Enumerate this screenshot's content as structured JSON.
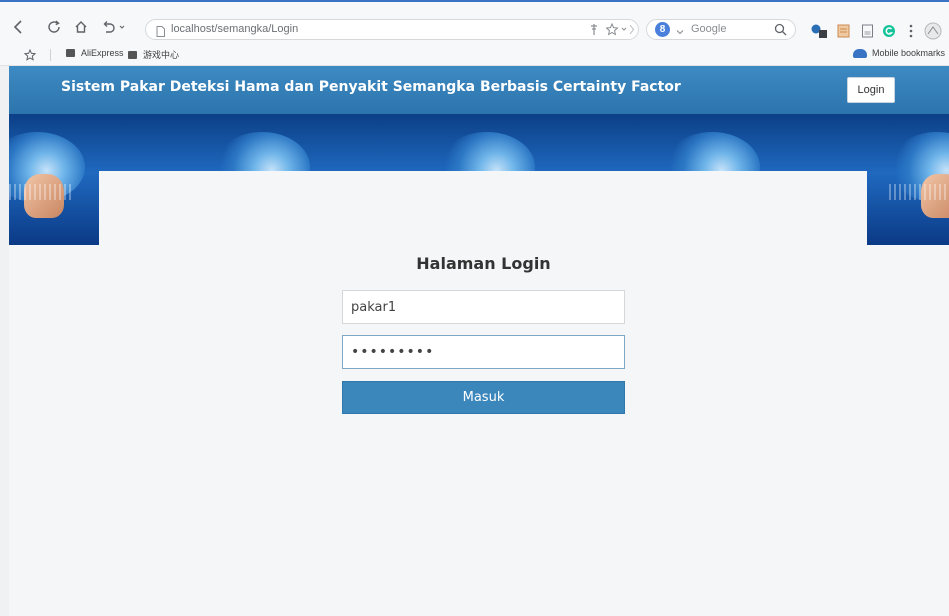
{
  "browser": {
    "url": "localhost/semangka/Login",
    "search_engine": "Google",
    "search_engine_badge": "8",
    "bookmarks": [
      "AliExpress",
      "游戏中心"
    ],
    "mobile_bookmarks": "Mobile bookmarks"
  },
  "header": {
    "title": "Sistem Pakar Deteksi Hama dan Penyakit Semangka Berbasis Certainty Factor",
    "login_label": "Login"
  },
  "login": {
    "heading": "Halaman Login",
    "username_value": "pakar1",
    "password_value": "•••••••••",
    "submit_label": "Masuk"
  },
  "colors": {
    "header_bg": "#3584bd",
    "button_bg": "#3b87bc",
    "banner_bg": "#1a5ab0"
  }
}
